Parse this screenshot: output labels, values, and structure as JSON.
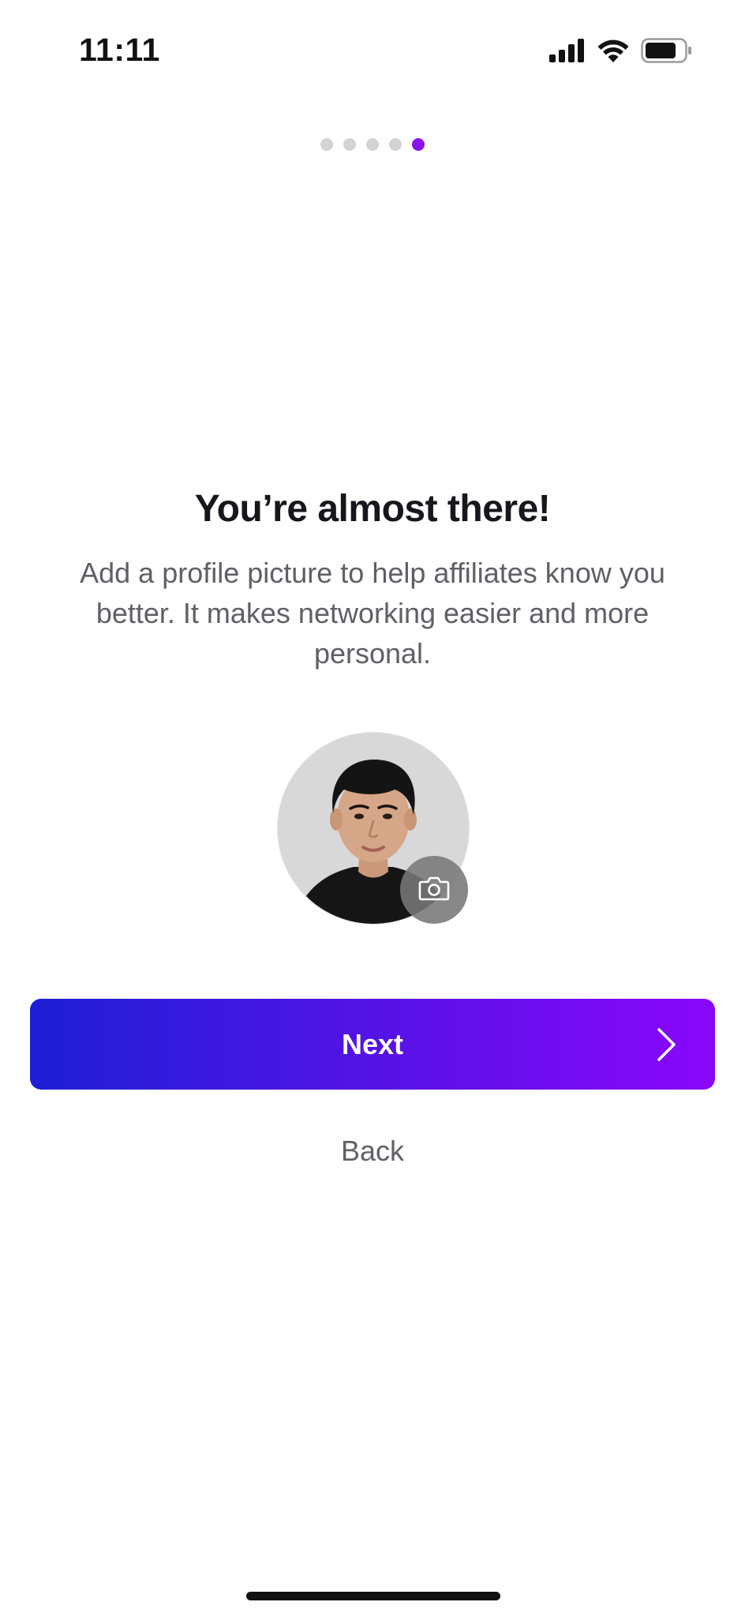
{
  "status_bar": {
    "time": "11:11",
    "icons": [
      "cellular-signal-icon",
      "wifi-icon",
      "battery-icon"
    ]
  },
  "pager": {
    "total_steps": 5,
    "current_step": 5,
    "active_color": "#8a12f0",
    "inactive_color": "#d3d3d6"
  },
  "onboarding": {
    "title": "You’re almost there!",
    "description": "Add a profile picture to help affiliates know you better.  It makes networking easier and more personal."
  },
  "avatar": {
    "image": "profile-photo",
    "edit_icon": "camera-icon"
  },
  "actions": {
    "next_label": "Next",
    "next_icon": "chevron-right-icon",
    "back_label": "Back",
    "gradient_start": "#1d1fd6",
    "gradient_end": "#8a06fb"
  }
}
